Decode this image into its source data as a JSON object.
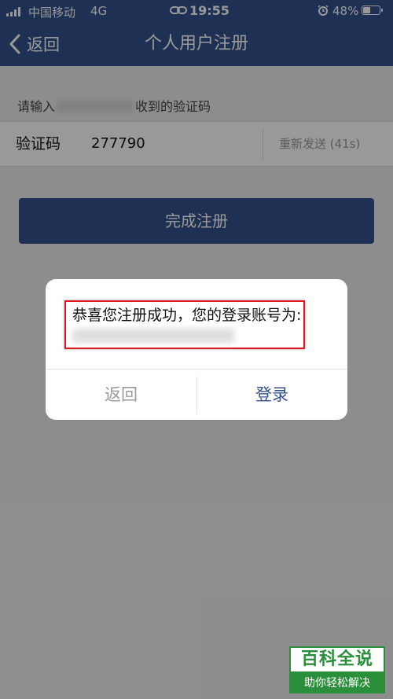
{
  "status_bar": {
    "carrier": "中国移动",
    "network": "4G",
    "time": "19:55",
    "battery": "48%",
    "battery_level": 0.48
  },
  "nav": {
    "back_label": "返回",
    "title": "个人用户注册"
  },
  "form": {
    "hint_prefix": "请输入",
    "hint_suffix": "收到的验证码",
    "code_label": "验证码",
    "code_value": "277790",
    "resend_label": "重新发送 (41s)",
    "submit_label": "完成注册"
  },
  "dialog": {
    "message": "恭喜您注册成功，您的登录账号为:",
    "cancel_label": "返回",
    "login_label": "登录"
  },
  "watermark": {
    "title": "百科全说",
    "subtitle": "助你轻松解决"
  },
  "colors": {
    "brand": "#33508a",
    "highlight": "#e0141b",
    "watermark": "#2a8e3a"
  }
}
